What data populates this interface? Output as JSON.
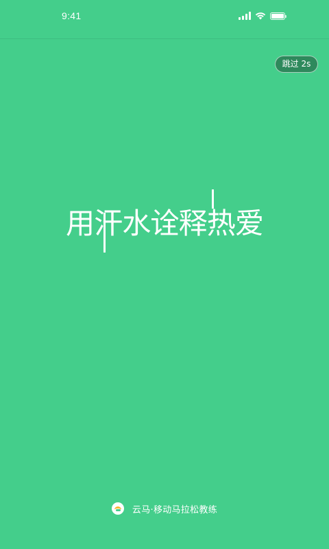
{
  "status_bar": {
    "time": "9:41",
    "icons": [
      "signal-icon",
      "wifi-icon",
      "battery-icon"
    ]
  },
  "skip": {
    "label": "跳过 2s"
  },
  "slogan": {
    "text": "用汗水诠释热爱"
  },
  "footer": {
    "logo_icon": "app-logo-icon",
    "brand": "云马·移动马拉松教练"
  },
  "colors": {
    "background": "#44CE8B",
    "text": "#FFFFFF",
    "skip_button_bg": "#2F7A54",
    "logo_accent": "#F5B731"
  }
}
